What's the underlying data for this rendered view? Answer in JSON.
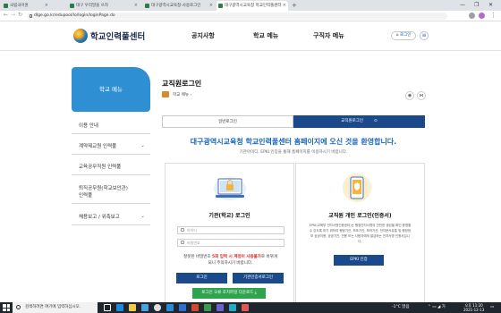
{
  "browser": {
    "tabs": [
      {
        "label": "국립국어원"
      },
      {
        "label": "대구 우리말을 쓰자"
      },
      {
        "label": "대구광역시교육청-사용로그인"
      },
      {
        "label": "대구광역시교육청 학교인력풀센터"
      }
    ],
    "new_tab": "+",
    "url": "dlge.go.kr/edupool/lo/login/loginPage.do",
    "win_min": "—",
    "win_max": "❐",
    "win_close": "✕"
  },
  "site": {
    "logo_text": "학교인력풀센터",
    "nav": [
      "공지사항",
      "학교 메뉴",
      "구직자 메뉴"
    ],
    "login_label": "로그인",
    "menu_icon": "≡"
  },
  "sidebar": {
    "title": "학교 메뉴",
    "items": [
      {
        "label": "이용 안내",
        "chevron": ""
      },
      {
        "label": "계약제교원 인력풀",
        "chevron": "⌄"
      },
      {
        "label": "교육공무직원 인력풀",
        "chevron": ""
      },
      {
        "label": "퇴직공무원(학교보안관)",
        "label2": "인력풀",
        "chevron": ""
      },
      {
        "label": "채용보고 / 위촉보고",
        "chevron": "⌄"
      }
    ]
  },
  "main": {
    "page_title": "교직원로그인",
    "breadcrumb": "학교 메뉴",
    "breadcrumb_sep": "›",
    "tabs": {
      "general": "일반로그인",
      "staff": "교직원로그인",
      "check": "⊙"
    },
    "welcome": "대구광역시교육청 학교인력풀센터 홈페이지에 오신 것을 환영합니다.",
    "sub": "기관아이디, EPKI 인증을 통해 홈페이지를 이용하시기 바랍니다.",
    "left_box": {
      "title": "기관(학교) 로그인",
      "id_placeholder": "아이디",
      "pw_placeholder": "비밀번호",
      "warn_a": "잘못된 비밀번호 ",
      "warn_red": "5회 입력 시 계정이 사용불가",
      "warn_b": "로 바뀌게",
      "warn_c": "되니 주의하시기 바랍니다.",
      "login_btn": "로그인",
      "cert_btn": "기관인증서로그인",
      "dl_btn": "로그인 오류 조치파일 다운로드"
    },
    "right_box": {
      "title": "교직원 개인 로그인(인증서)",
      "text": "EPKI(교육부 전자서명인증센터)는 행정전자서명의 안전한 생성을 확인·증명할 수 있도록 하기 위하여 행정기관, 보조기관, 보좌기관, 전자문서유통 및 행정정보 공공이용, 공공기관, 전용 또는 사용자에게 발급하는 전자서명 인증서입니다.",
      "epki_btn": "EPKI 인증"
    }
  },
  "taskbar": {
    "search_placeholder": "검색하려면 여기에 입력하십시오.",
    "weather": "-1°C 맑음",
    "time": "오후 11:20",
    "date": "2021-12-13"
  }
}
